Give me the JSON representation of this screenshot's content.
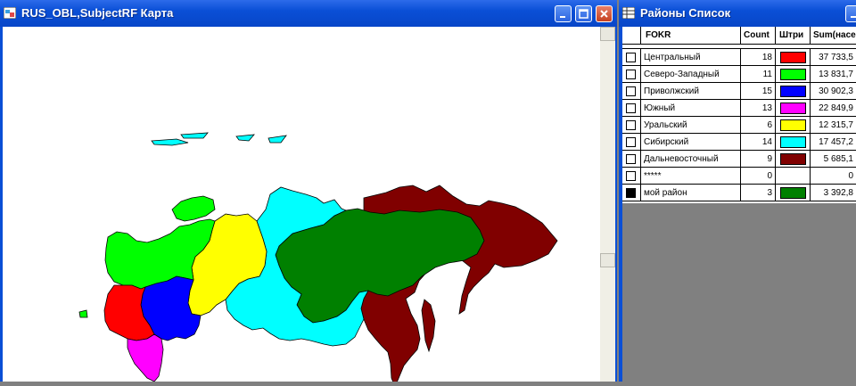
{
  "map_window": {
    "title": "RUS_OBL,SubjectRF Карта"
  },
  "list_window": {
    "title": "Районы Список",
    "columns": [
      "FOKR",
      "Count",
      "Штри",
      "Sum(насе"
    ],
    "rows": [
      {
        "name": "Центральный",
        "count": "18",
        "color": "#ff0000",
        "sum": "37 733,5",
        "selected": false
      },
      {
        "name": "Северо-Западный",
        "count": "11",
        "color": "#00ff00",
        "sum": "13 831,7",
        "selected": false
      },
      {
        "name": "Приволжский",
        "count": "15",
        "color": "#0000ff",
        "sum": "30 902,3",
        "selected": false
      },
      {
        "name": "Южный",
        "count": "13",
        "color": "#ff00ff",
        "sum": "22 849,9",
        "selected": false
      },
      {
        "name": "Уральский",
        "count": "6",
        "color": "#ffff00",
        "sum": "12 315,7",
        "selected": false
      },
      {
        "name": "Сибирский",
        "count": "14",
        "color": "#00ffff",
        "sum": "17 457,2",
        "selected": false
      },
      {
        "name": "Дальневосточный",
        "count": "9",
        "color": "#800000",
        "sum": "5 685,1",
        "selected": false
      },
      {
        "name": "*****",
        "count": "0",
        "color": "",
        "sum": "0",
        "selected": false
      },
      {
        "name": "мой район",
        "count": "3",
        "color": "#008000",
        "sum": "3 392,8",
        "selected": true
      }
    ]
  },
  "map_regions": [
    {
      "name": "Центральный",
      "color": "#ff0000"
    },
    {
      "name": "Северо-Западный",
      "color": "#00ff00"
    },
    {
      "name": "Приволжский",
      "color": "#0000ff"
    },
    {
      "name": "Южный",
      "color": "#ff00ff"
    },
    {
      "name": "Уральский",
      "color": "#ffff00"
    },
    {
      "name": "Сибирский",
      "color": "#00ffff"
    },
    {
      "name": "Дальневосточный",
      "color": "#800000"
    },
    {
      "name": "мой район",
      "color": "#008000"
    }
  ]
}
